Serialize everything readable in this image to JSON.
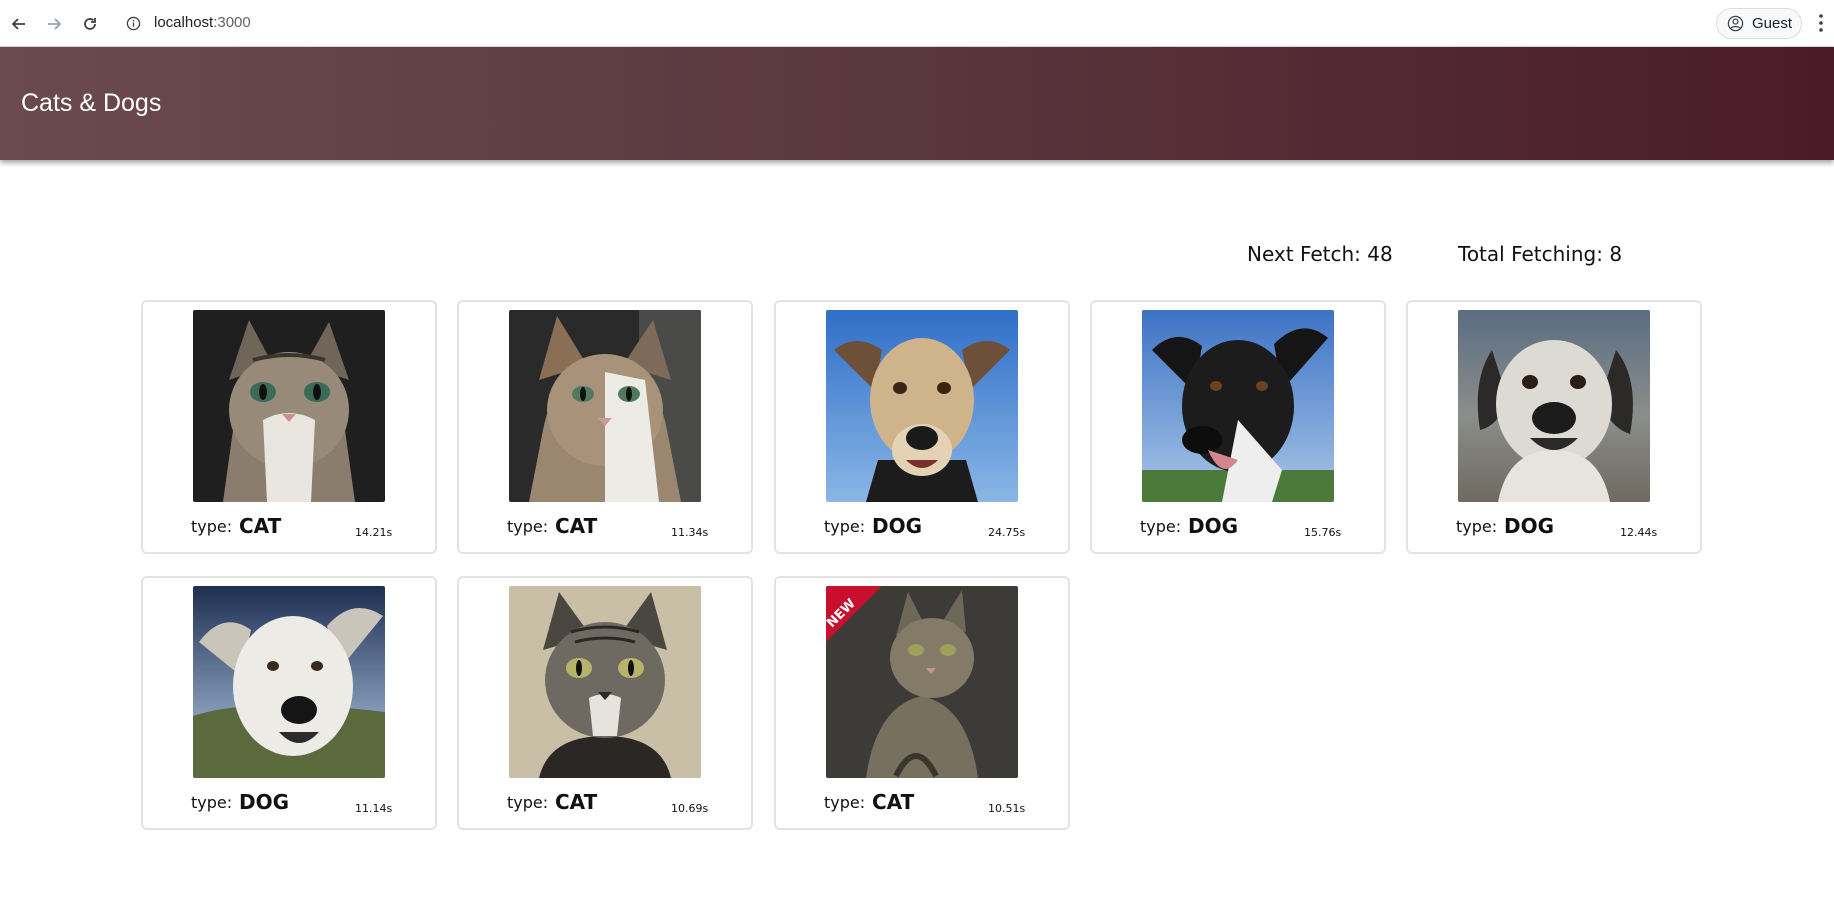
{
  "browser": {
    "url_host": "localhost",
    "url_port": ":3000",
    "profile_label": "Guest"
  },
  "header": {
    "title": "Cats & Dogs"
  },
  "stats": {
    "next_fetch": "Next Fetch: 48",
    "total_fetching": "Total Fetching: 8"
  },
  "cards": [
    {
      "type_label": "type:",
      "type": "CAT",
      "time": "14.21s"
    },
    {
      "type_label": "type:",
      "type": "CAT",
      "time": "11.34s"
    },
    {
      "type_label": "type:",
      "type": "DOG",
      "time": "24.75s"
    },
    {
      "type_label": "type:",
      "type": "DOG",
      "time": "15.76s"
    },
    {
      "type_label": "type:",
      "type": "DOG",
      "time": "12.44s"
    },
    {
      "type_label": "type:",
      "type": "DOG",
      "time": "11.14s"
    },
    {
      "type_label": "type:",
      "type": "CAT",
      "time": "10.69s"
    },
    {
      "type_label": "type:",
      "type": "CAT",
      "time": "10.51s",
      "badge": "NEW"
    }
  ]
}
